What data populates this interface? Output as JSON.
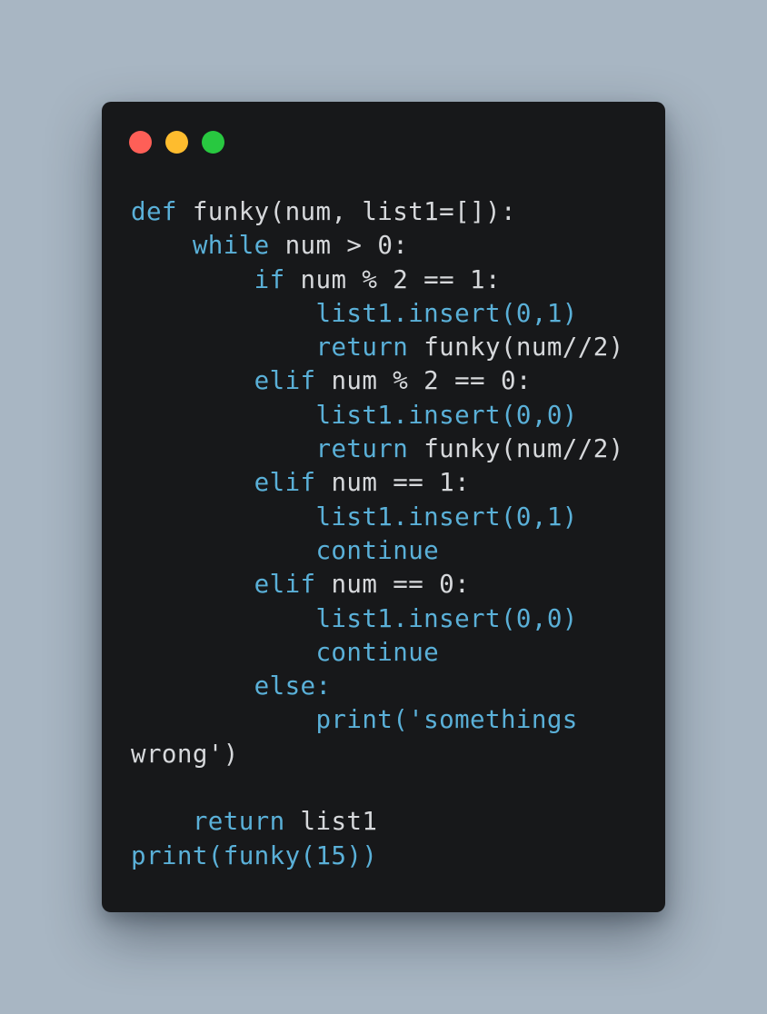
{
  "window": {
    "traffic_lights": [
      {
        "name": "close",
        "color": "#fe5f57"
      },
      {
        "name": "minimize",
        "color": "#febc2e"
      },
      {
        "name": "zoom",
        "color": "#28c840"
      }
    ]
  },
  "colors": {
    "keyword": "#5ab0d8",
    "plain": "#d6d8db"
  },
  "code_lines": [
    [
      {
        "t": "def",
        "c": "keyword"
      },
      {
        "t": " funky(num, list1=[]):",
        "c": "plain"
      }
    ],
    [
      {
        "t": "    ",
        "c": "plain"
      },
      {
        "t": "while",
        "c": "keyword"
      },
      {
        "t": " num > 0:",
        "c": "plain"
      }
    ],
    [
      {
        "t": "        ",
        "c": "plain"
      },
      {
        "t": "if",
        "c": "keyword"
      },
      {
        "t": " num % 2 == 1:",
        "c": "plain"
      }
    ],
    [
      {
        "t": "            list1.insert(0,1)",
        "c": "keyword"
      }
    ],
    [
      {
        "t": "            ",
        "c": "plain"
      },
      {
        "t": "return",
        "c": "keyword"
      },
      {
        "t": " funky(num//2)",
        "c": "plain"
      }
    ],
    [
      {
        "t": "        ",
        "c": "plain"
      },
      {
        "t": "elif",
        "c": "keyword"
      },
      {
        "t": " num % 2 == 0:",
        "c": "plain"
      }
    ],
    [
      {
        "t": "            list1.insert(0,0)",
        "c": "keyword"
      }
    ],
    [
      {
        "t": "            ",
        "c": "plain"
      },
      {
        "t": "return",
        "c": "keyword"
      },
      {
        "t": " funky(num//2)",
        "c": "plain"
      }
    ],
    [
      {
        "t": "        ",
        "c": "plain"
      },
      {
        "t": "elif",
        "c": "keyword"
      },
      {
        "t": " num == 1:",
        "c": "plain"
      }
    ],
    [
      {
        "t": "            list1.insert(0,1)",
        "c": "keyword"
      }
    ],
    [
      {
        "t": "            continue",
        "c": "keyword"
      }
    ],
    [
      {
        "t": "        ",
        "c": "plain"
      },
      {
        "t": "elif",
        "c": "keyword"
      },
      {
        "t": " num == 0:",
        "c": "plain"
      }
    ],
    [
      {
        "t": "            list1.insert(0,0)",
        "c": "keyword"
      }
    ],
    [
      {
        "t": "            continue",
        "c": "keyword"
      }
    ],
    [
      {
        "t": "        else:",
        "c": "keyword"
      }
    ],
    [
      {
        "t": "            print('somethings",
        "c": "keyword"
      }
    ],
    [
      {
        "t": "wrong')",
        "c": "plain"
      }
    ],
    [],
    [
      {
        "t": "    ",
        "c": "plain"
      },
      {
        "t": "return",
        "c": "keyword"
      },
      {
        "t": " list1",
        "c": "plain"
      }
    ],
    [
      {
        "t": "print(funky(15))",
        "c": "keyword"
      }
    ]
  ]
}
